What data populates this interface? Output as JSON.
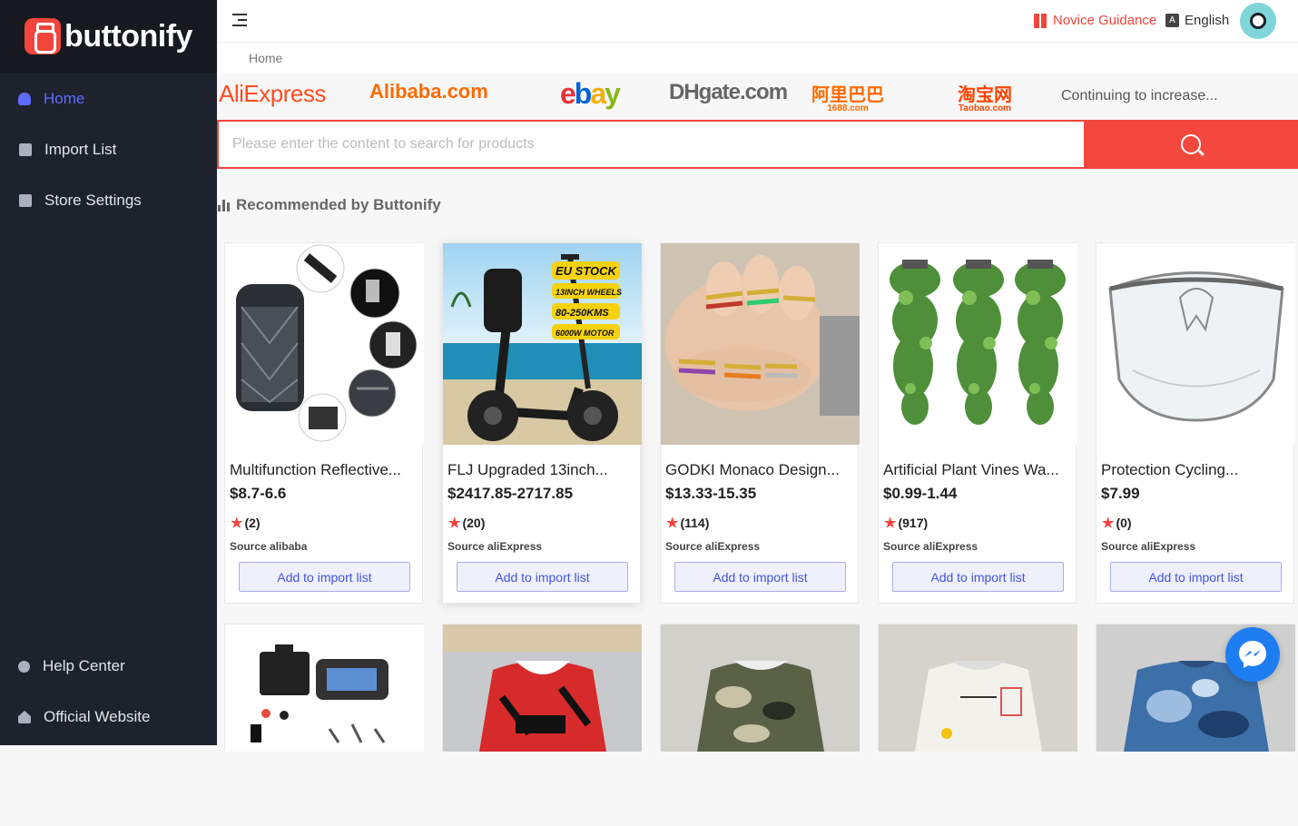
{
  "brand": {
    "name": "buttonify"
  },
  "sidebar": {
    "items": [
      {
        "label": "Home"
      },
      {
        "label": "Import List"
      },
      {
        "label": "Store Settings"
      }
    ],
    "footer": [
      {
        "label": "Help Center"
      },
      {
        "label": "Official Website"
      }
    ]
  },
  "header": {
    "novice_label": "Novice Guidance",
    "language_icon_text": "A",
    "language": "English"
  },
  "breadcrumb": {
    "home": "Home"
  },
  "platforms": {
    "aliexpress": "AliExpress",
    "alibaba": "Alibaba.com",
    "ebay": [
      "e",
      "b",
      "a",
      "y"
    ],
    "dhgate": "DHgate.com",
    "a1688_main": "阿里巴巴",
    "a1688_sub": "1688.com",
    "taobao_main": "淘宝网",
    "taobao_sub": "Taobao.com",
    "more": "Continuing to increase..."
  },
  "search": {
    "placeholder": "Please enter the content to search for products",
    "value": ""
  },
  "section": {
    "title": "Recommended by Buttonify"
  },
  "products": [
    {
      "title": "Multifunction Reflective...",
      "price": "$8.7-6.6",
      "rating": "(2)",
      "source": "Source alibaba",
      "button": "Add to import list"
    },
    {
      "title": "FLJ Upgraded 13inch...",
      "price": "$2417.85-2717.85",
      "rating": "(20)",
      "source": "Source aliExpress",
      "button": "Add to import list",
      "badges": [
        "EU STOCK",
        "13INCH WHEELS",
        "80-250KMS",
        "6000W MOTOR"
      ]
    },
    {
      "title": "GODKI Monaco Design...",
      "price": "$13.33-15.35",
      "rating": "(114)",
      "source": "Source aliExpress",
      "button": "Add to import list"
    },
    {
      "title": "Artificial Plant Vines Wa...",
      "price": "$0.99-1.44",
      "rating": "(917)",
      "source": "Source aliExpress",
      "button": "Add to import list"
    },
    {
      "title": "Protection Cycling...",
      "price": "$7.99",
      "rating": "(0)",
      "source": "Source aliExpress",
      "button": "Add to import list"
    }
  ],
  "colors": {
    "accent": "#f2453d",
    "sidebar_bg": "#1e222d",
    "active_nav": "#5e6bff",
    "button_text": "#4553dd"
  }
}
